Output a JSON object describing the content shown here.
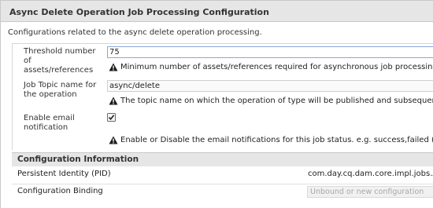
{
  "header": {
    "title": "Async Delete Operation Job Processing Configuration"
  },
  "intro": "Configurations related to the async delete operation processing.",
  "fields": [
    {
      "label": "Threshold number of assets/references",
      "value": "75",
      "help": "Minimum number of assets/references required for asynchronous job processing."
    },
    {
      "label": "Job Topic name for the operation",
      "value": "async/delete",
      "help": "The topic name on which the operation of type will be published and subsequently"
    },
    {
      "label": "Enable email notification",
      "checked": true,
      "help": "Enable or Disable the email notifications for this job status. e.g. success,failed (en"
    }
  ],
  "icons": {
    "warning": "warning-icon",
    "checkmark": "checkmark-icon"
  },
  "config_info": {
    "title": "Configuration Information",
    "pid_label": "Persistent Identity (PID)",
    "pid_value": "com.day.cq.dam.core.impl.jobs.A",
    "binding_label": "Configuration Binding",
    "binding_value": "Unbound or new configuration"
  }
}
